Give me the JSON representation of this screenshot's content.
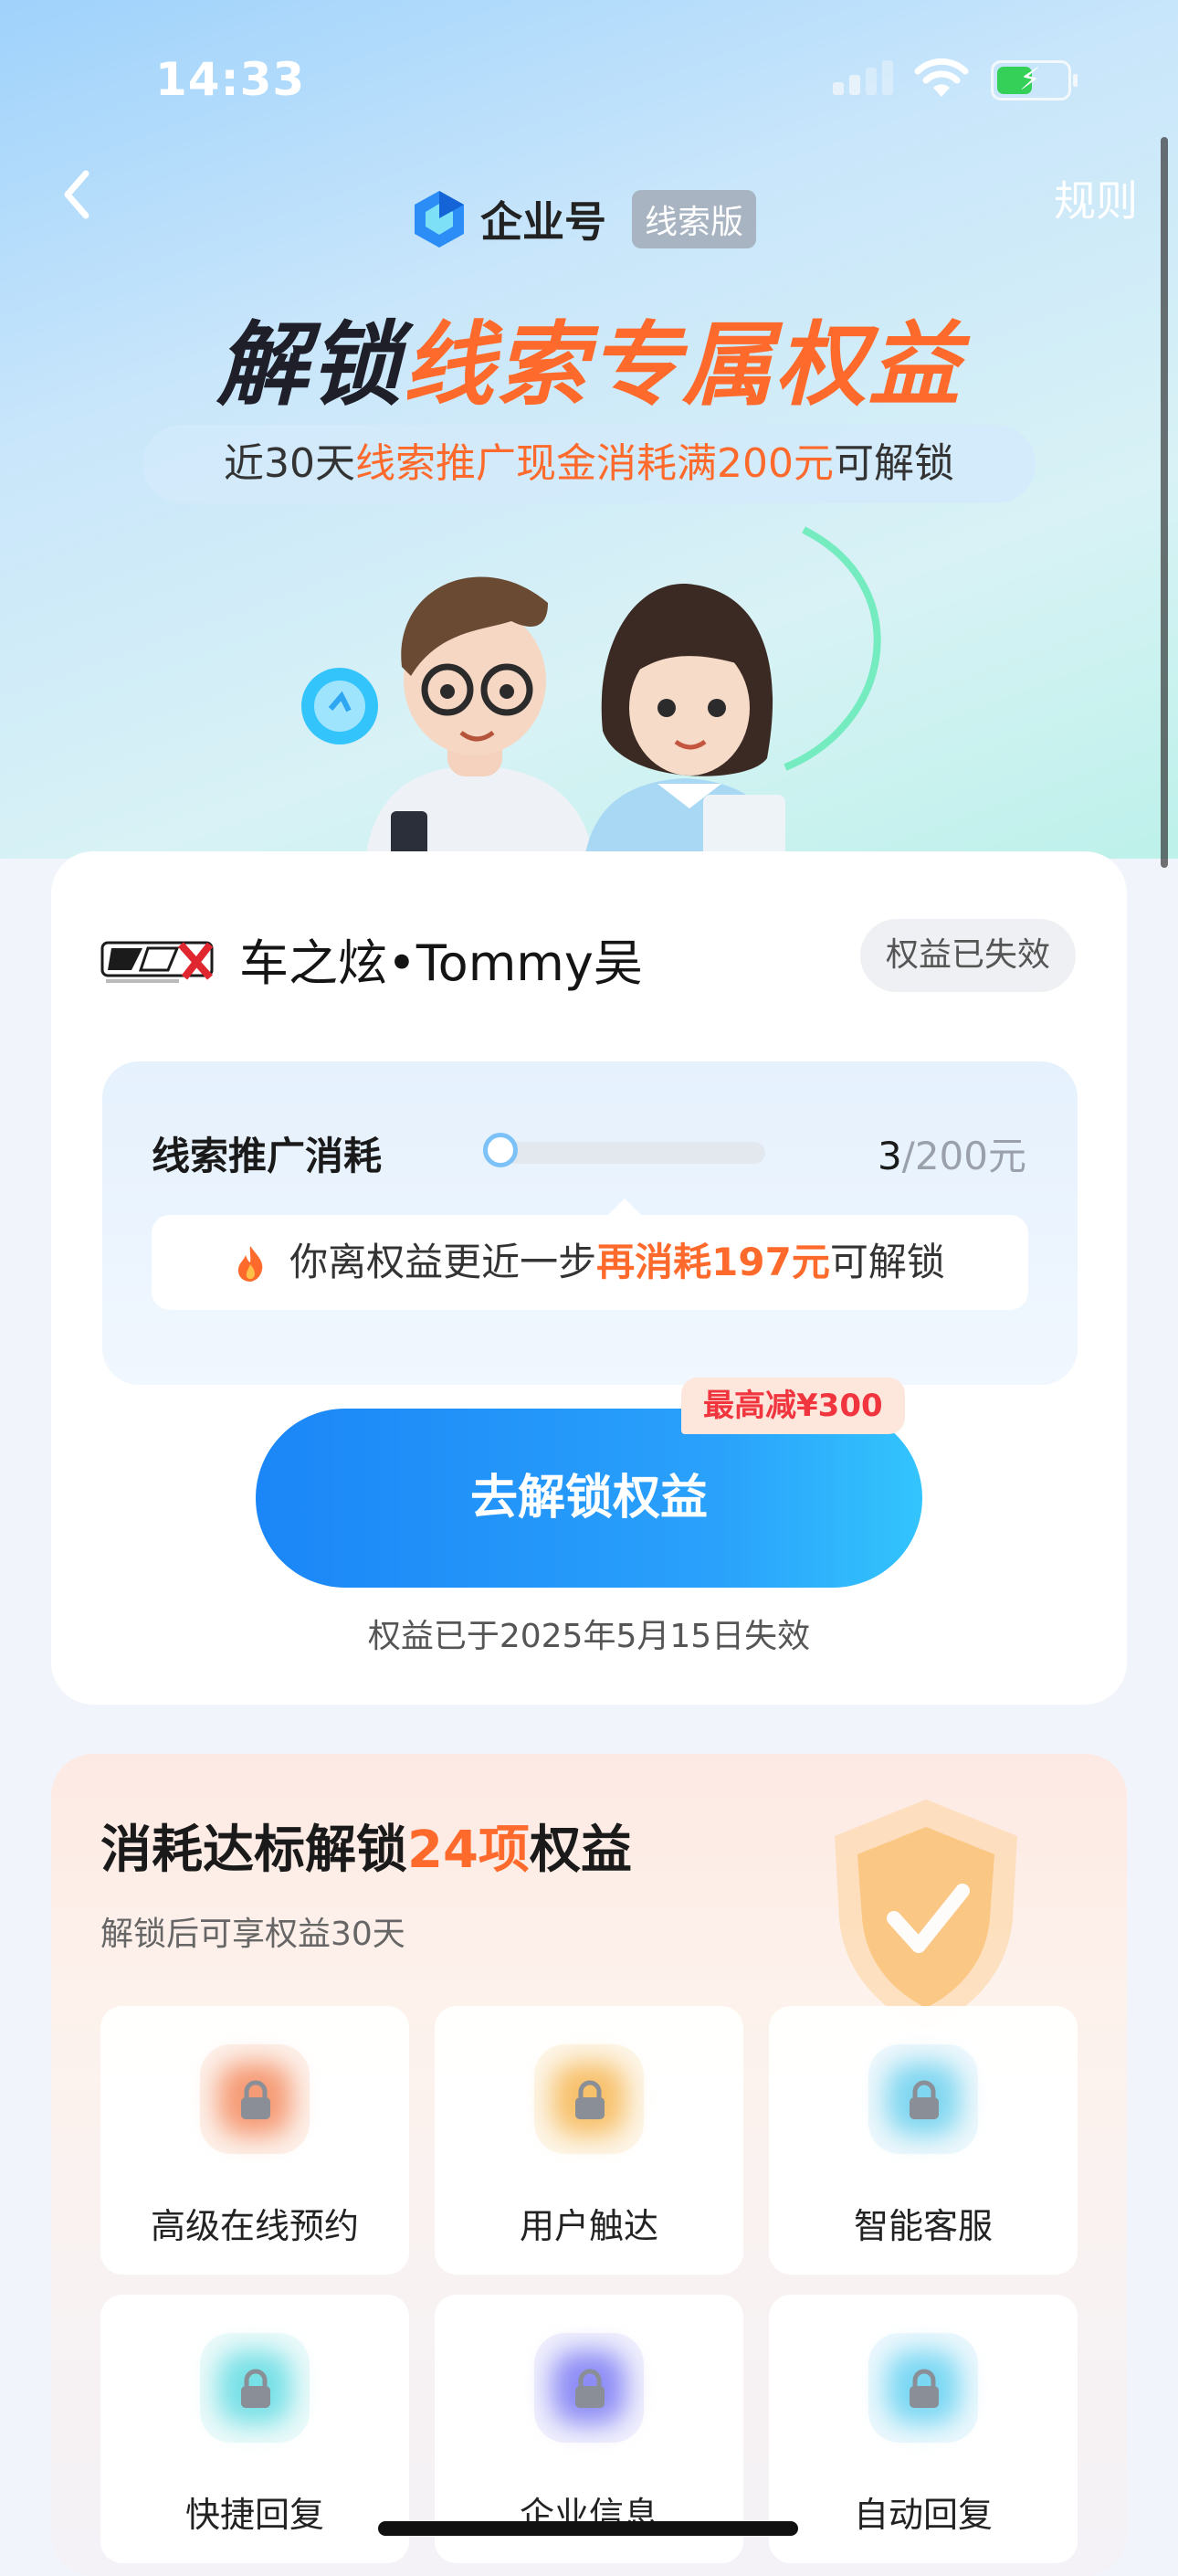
{
  "status_bar": {
    "time": "14:33"
  },
  "nav": {
    "rules_label": "规则"
  },
  "brand": {
    "name": "企业号",
    "tag": "线索版"
  },
  "hero": {
    "headline_part1": "解锁",
    "headline_part2": "线索专属权益",
    "sub_part1": "近30天",
    "sub_part2": "线索推广现金消耗满200元",
    "sub_part3": "可解锁"
  },
  "account": {
    "name": "车之炫•Tommy吴",
    "status_badge": "权益已失效"
  },
  "progress": {
    "label": "线索推广消耗",
    "current": "3",
    "total": "/200元",
    "fraction": 0.015,
    "tip_part1": "你离权益更近一步",
    "tip_part2": "再消耗197元",
    "tip_part3": "可解锁"
  },
  "cta": {
    "label": "去解锁权益",
    "promo": "最高减¥300",
    "expired_note": "权益已于2025年5月15日失效"
  },
  "benefits": {
    "title_part1": "消耗达标解锁",
    "title_part2": "24项",
    "title_part3": "权益",
    "subtitle": "解锁后可享权益30天",
    "items": [
      {
        "label": "高级在线预约",
        "icon": "lock-icon",
        "color": "#f59a74"
      },
      {
        "label": "用户触达",
        "icon": "lock-icon",
        "color": "#f7c06a"
      },
      {
        "label": "智能客服",
        "icon": "lock-icon",
        "color": "#7fd6f0"
      },
      {
        "label": "快捷回复",
        "icon": "lock-icon",
        "color": "#76e0e6"
      },
      {
        "label": "企业信息",
        "icon": "lock-icon",
        "color": "#8d8cf5"
      },
      {
        "label": "自动回复",
        "icon": "lock-icon",
        "color": "#7ad7f3"
      }
    ]
  },
  "colors": {
    "accent_orange": "#fe6a2c",
    "cta_blue": "#1b86f7",
    "promo_red": "#f0353e"
  }
}
